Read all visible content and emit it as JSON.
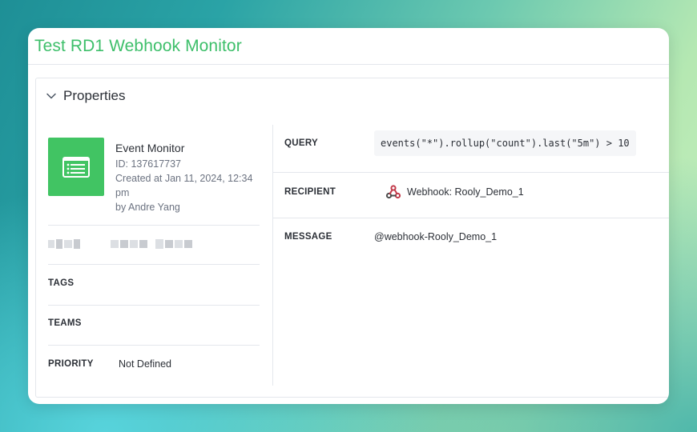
{
  "window": {
    "title": "Test RD1 Webhook Monitor"
  },
  "properties_panel": {
    "title": "Properties",
    "monitor": {
      "type": "Event Monitor",
      "id": "ID: 137617737",
      "created": "Created at Jan 11, 2024, 12:34 pm",
      "author": "by Andre Yang",
      "icon": "list-icon"
    },
    "tags": {
      "label": "TAGS",
      "value": ""
    },
    "teams": {
      "label": "TEAMS",
      "value": ""
    },
    "priority": {
      "label": "PRIORITY",
      "value": "Not Defined"
    }
  },
  "details": {
    "query": {
      "label": "QUERY",
      "value": "events(\"*\").rollup(\"count\").last(\"5m\") > 10"
    },
    "recipient": {
      "label": "RECIPIENT",
      "value": "Webhook: Rooly_Demo_1",
      "icon": "webhook-icon"
    },
    "message": {
      "label": "MESSAGE",
      "value": "@webhook-Rooly_Demo_1"
    }
  },
  "colors": {
    "accent": "#3dbf6a",
    "monitor_icon_bg": "#41c463",
    "webhook_icon": "#c23a4a"
  }
}
